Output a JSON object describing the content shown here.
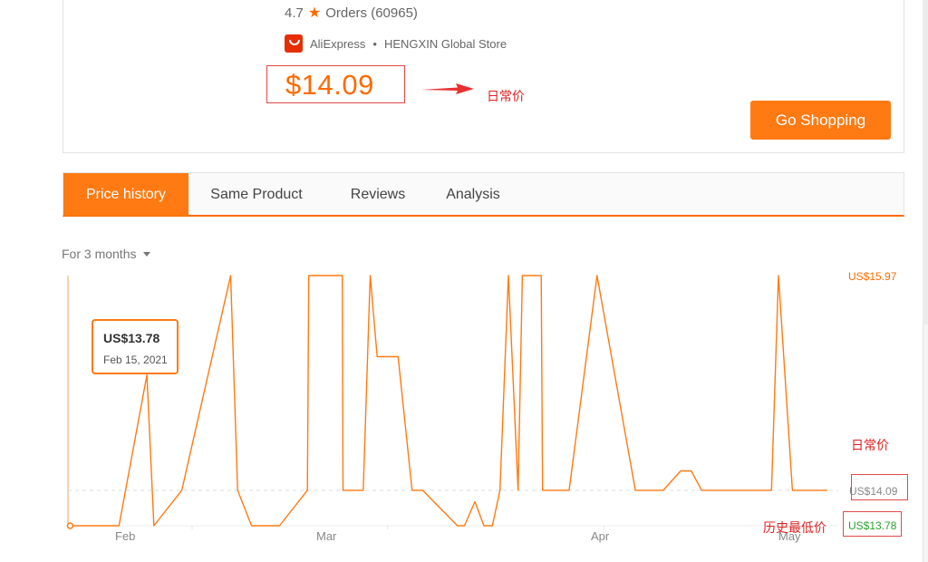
{
  "product": {
    "rating": "4.7",
    "orders": "Orders (60965)",
    "marketplace": "AliExpress",
    "separator": "•",
    "store": "HENGXIN Global Store",
    "price": "$14.09",
    "go_shopping": "Go Shopping"
  },
  "annotations": {
    "daily_price": "日常价",
    "daily_price_2": "日常价",
    "lowest_price": "历史最低价",
    "color": "#e02020"
  },
  "tabs": [
    {
      "label": "Price history",
      "active": true
    },
    {
      "label": "Same Product",
      "active": false
    },
    {
      "label": "Reviews",
      "active": false
    },
    {
      "label": "Analysis",
      "active": false
    }
  ],
  "range": {
    "label": "For 3 months"
  },
  "tooltip": {
    "price": "US$13.78",
    "date": "Feb 15, 2021"
  },
  "colors": {
    "accent": "#ff7a12",
    "max_label": "#ff6a00",
    "min_label": "#2ca02c"
  },
  "chart_data": {
    "type": "line",
    "currency": "US$",
    "ylim": [
      13.78,
      15.97
    ],
    "y_labels": {
      "max": "US$15.97",
      "current": "US$14.09",
      "min": "US$13.78"
    },
    "x_ticks": [
      {
        "label": "Feb",
        "day": 0
      },
      {
        "label": "Mar",
        "day": 28
      },
      {
        "label": "Apr",
        "day": 59
      },
      {
        "label": "May",
        "day": 89
      }
    ],
    "series": [
      {
        "points": [
          [
            -8,
            13.78
          ],
          [
            -1,
            13.78
          ],
          [
            3,
            15.1
          ],
          [
            4,
            13.78
          ],
          [
            8,
            14.09
          ],
          [
            15,
            15.97
          ],
          [
            16,
            14.09
          ],
          [
            18,
            13.78
          ],
          [
            22,
            13.78
          ],
          [
            26,
            14.09
          ],
          [
            26.2,
            15.97
          ],
          [
            31,
            15.97
          ],
          [
            31.1,
            14.09
          ],
          [
            34,
            14.09
          ],
          [
            35,
            15.97
          ],
          [
            36,
            15.26
          ],
          [
            39,
            15.26
          ],
          [
            41,
            14.09
          ],
          [
            42.5,
            14.09
          ],
          [
            47.5,
            13.78
          ],
          [
            48.5,
            13.78
          ],
          [
            50,
            13.99
          ],
          [
            51.3,
            13.78
          ],
          [
            52.5,
            13.78
          ],
          [
            53.6,
            14.09
          ],
          [
            54.8,
            15.97
          ],
          [
            56.2,
            14.09
          ],
          [
            56.8,
            15.97
          ],
          [
            59.5,
            15.97
          ],
          [
            59.7,
            14.09
          ],
          [
            63.5,
            14.09
          ],
          [
            67.5,
            15.97
          ],
          [
            73,
            14.09
          ],
          [
            77,
            14.09
          ],
          [
            79.5,
            14.26
          ],
          [
            81,
            14.26
          ],
          [
            82.5,
            14.09
          ],
          [
            92.5,
            14.09
          ],
          [
            93.5,
            15.97
          ],
          [
            95.5,
            14.09
          ],
          [
            100.5,
            14.09
          ]
        ]
      }
    ]
  }
}
